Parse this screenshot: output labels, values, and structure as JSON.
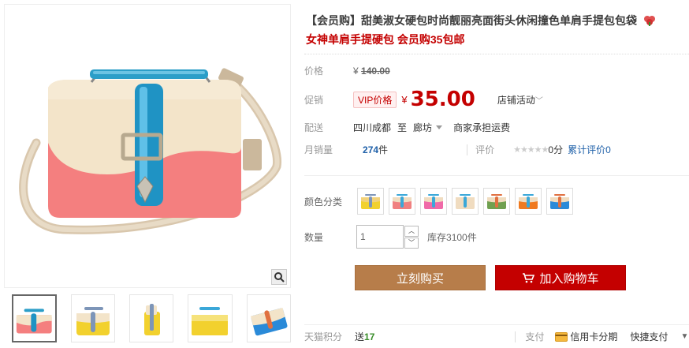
{
  "product": {
    "title": "【会员购】甜美淑女硬包时尚靓丽亮面街头休闲撞色单肩手提包包袋",
    "subtitle": "女神单肩手提硬包 会员购35包邮"
  },
  "price": {
    "label": "价格",
    "currency": "¥",
    "original": "140.00"
  },
  "promo": {
    "label": "促销",
    "vip_badge": "VIP价格",
    "currency": "¥",
    "price": "35.00",
    "store_activity": "店铺活动"
  },
  "shipping": {
    "label": "配送",
    "from": "四川成都",
    "to_word": "至",
    "destination": "廊坊",
    "note": "商家承担运费"
  },
  "sales": {
    "label": "月销量",
    "count": "274",
    "unit": "件",
    "rating_label": "评价",
    "stars": "★★★★★",
    "score": "0分",
    "review_link": "累计评价0"
  },
  "sku": {
    "color_label": "颜色分类",
    "swatch_colors": [
      {
        "top": "#f2d27a",
        "bottom": "#f2d12e",
        "strap": "#7d95b8"
      },
      {
        "top": "#f0dcc0",
        "bottom": "#f08080",
        "strap": "#3aa7d8"
      },
      {
        "top": "#f0dcc0",
        "bottom": "#f06aa8",
        "strap": "#3aa7d8"
      },
      {
        "top": "#f0dcc0",
        "bottom": "#f0dcc0",
        "strap": "#3aa7d8"
      },
      {
        "top": "#f0dcc0",
        "bottom": "#70a050",
        "strap": "#e07040"
      },
      {
        "top": "#f0dcc0",
        "bottom": "#f07a20",
        "strap": "#3aa7d8"
      },
      {
        "top": "#f0dcc0",
        "bottom": "#2a8ad8",
        "strap": "#e07040"
      }
    ]
  },
  "quantity": {
    "label": "数量",
    "value": "1",
    "up": "︿",
    "down": "﹀",
    "stock": "库存3100件"
  },
  "actions": {
    "buy_now": "立刻购买",
    "add_to_cart": "加入购物车"
  },
  "bottom": {
    "points_label": "天猫积分",
    "points_prefix": "送",
    "points_value": "17",
    "pay_label": "支付",
    "credit_card": "信用卡分期",
    "quick_pay": "快捷支付"
  },
  "colors": {
    "accent_red": "#c40000",
    "buy_brown": "#b77d4a",
    "link_blue": "#1d5fa8"
  },
  "icons": {
    "zoom": "magnifier-icon",
    "cart": "cart-icon",
    "credit": "credit-card-icon",
    "badge": "flower-badge-icon"
  }
}
